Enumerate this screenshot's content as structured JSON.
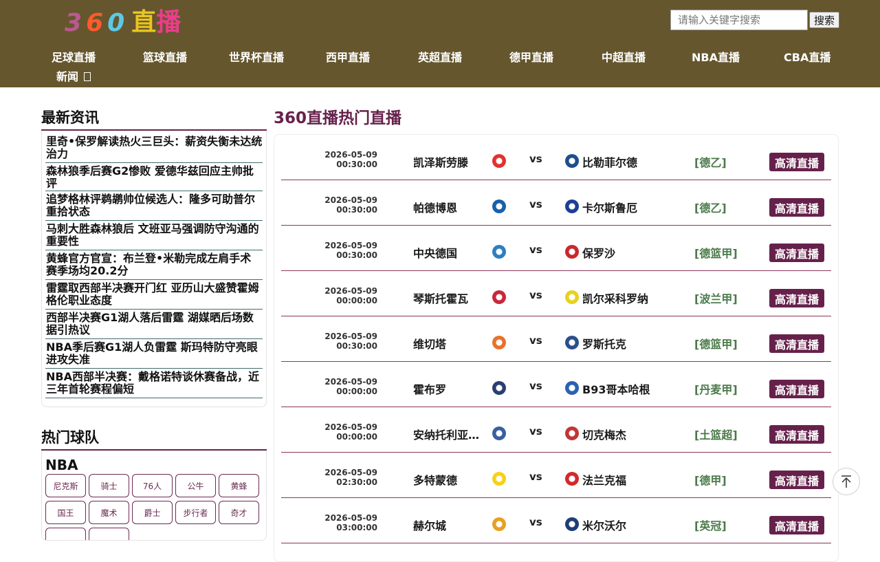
{
  "header": {
    "logo_digits": [
      "3",
      "6",
      "0"
    ],
    "logo_digit_colors": [
      "#b85a8e",
      "#ff5a2a",
      "#5bc9e6"
    ],
    "logo_chars": [
      "直",
      "播"
    ],
    "logo_char_colors": [
      "#e9c51e",
      "#ec3d8b"
    ],
    "search_placeholder": "请输入关键字搜索",
    "search_button": "搜索"
  },
  "nav": [
    "足球直播",
    "篮球直播",
    "世界杯直播",
    "西甲直播",
    "英超直播",
    "德甲直播",
    "中超直播",
    "NBA直播",
    "CBA直播",
    "新闻 "
  ],
  "news": {
    "title": "最新资讯",
    "items": [
      "里奇•保罗解读热火三巨头：薪资失衡未达统治力",
      "森林狼季后赛G2惨败 爱德华兹回应主帅批评",
      "追梦格林评鹈鹕帅位候选人：隆多可助普尔重拾状态",
      "马刺大胜森林狼后 文班亚马强调防守沟通的重要性",
      "黄蜂官方官宣：布兰登•米勒完成左肩手术 赛季场均20.2分",
      "雷霆取西部半决赛开门红 亚历山大盛赞霍姆格伦职业态度",
      "西部半决赛G1湖人落后雷霆 湖媒晒后场数据引热议",
      "NBA季后赛G1湖人负雷霆 斯玛特防守亮眼进攻失准",
      "NBA西部半决赛：戴格诺特谈休赛备战，近三年首轮赛程偏短"
    ]
  },
  "teams": {
    "title": "热门球队",
    "league": "NBA",
    "tags": [
      "尼克斯",
      "骑士",
      "76人",
      "公牛",
      "黄蜂",
      "国王",
      "魔术",
      "爵士",
      "步行者",
      "奇才"
    ]
  },
  "main": {
    "title": "360直播热门直播",
    "vs_label": "vs",
    "button_label": "高清直播",
    "matches": [
      {
        "date": "2026-05-09",
        "time": "00:30:00",
        "home": "凯泽斯劳滕",
        "away": "比勒菲尔德",
        "league": "[德乙]",
        "home_color": "#e3312d",
        "away_color": "#1f4e8c"
      },
      {
        "date": "2026-05-09",
        "time": "00:30:00",
        "home": "帕德博恩",
        "away": "卡尔斯鲁厄",
        "league": "[德乙]",
        "home_color": "#1a5fa8",
        "away_color": "#1c3f95"
      },
      {
        "date": "2026-05-09",
        "time": "00:30:00",
        "home": "中央德国",
        "away": "保罗沙",
        "league": "[德篮甲]",
        "home_color": "#2c7fc1",
        "away_color": "#c9282d"
      },
      {
        "date": "2026-05-09",
        "time": "00:00:00",
        "home": "琴斯托霍瓦",
        "away": "凯尔采科罗纳",
        "league": "[波兰甲]",
        "home_color": "#c8283a",
        "away_color": "#e7d21e"
      },
      {
        "date": "2026-05-09",
        "time": "00:30:00",
        "home": "维切塔",
        "away": "罗斯托克",
        "league": "[德篮甲]",
        "home_color": "#e8722a",
        "away_color": "#2a4f8f"
      },
      {
        "date": "2026-05-09",
        "time": "00:00:00",
        "home": "霍布罗",
        "away": "B93哥本哈根",
        "league": "[丹麦甲]",
        "home_color": "#2b3f6e",
        "away_color": "#2a62b3"
      },
      {
        "date": "2026-05-09",
        "time": "00:00:00",
        "home": "安纳托利亚埃费斯",
        "away": "切克梅杰",
        "league": "[土篮超]",
        "home_color": "#3a5fa0",
        "away_color": "#c33536"
      },
      {
        "date": "2026-05-09",
        "time": "02:30:00",
        "home": "多特蒙德",
        "away": "法兰克福",
        "league": "[德甲]",
        "home_color": "#f7d117",
        "away_color": "#d22a2a"
      },
      {
        "date": "2026-05-09",
        "time": "03:00:00",
        "home": "赫尔城",
        "away": "米尔沃尔",
        "league": "[英冠]",
        "home_color": "#e8a021",
        "away_color": "#1f3e78"
      }
    ]
  }
}
